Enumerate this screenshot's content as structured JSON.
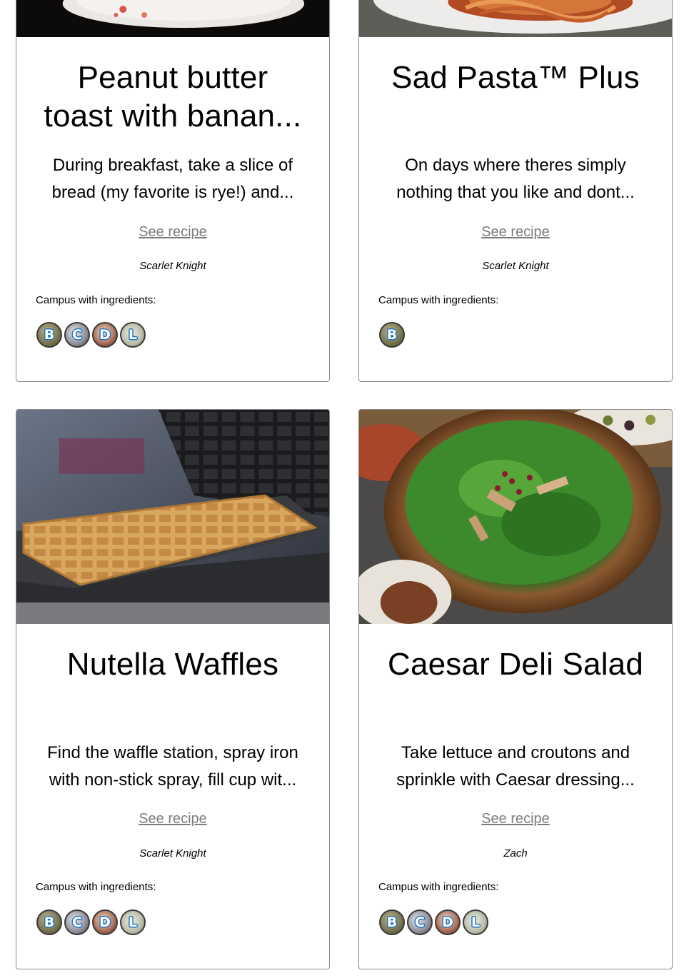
{
  "cards": [
    {
      "title": "Peanut butter toast with banan...",
      "title_line1": "Peanut butter",
      "title_line2": "toast with banan...",
      "desc_line1": "During breakfast, take a slice of",
      "desc_line2": "bread (my favorite is rye!) and...",
      "link": "See recipe",
      "author": "Scarlet Knight",
      "campus_label": "Campus with ingredients:",
      "campuses": [
        "B",
        "C",
        "D",
        "L"
      ]
    },
    {
      "title_line1": "Sad Pasta™ Plus",
      "desc_line1": "On days where theres simply",
      "desc_line2": "nothing that you like and dont...",
      "link": "See recipe",
      "author": "Scarlet Knight",
      "campus_label": "Campus with ingredients:",
      "campuses": [
        "B"
      ]
    },
    {
      "title_line1": "Nutella Waffles",
      "desc_line1": "Find the waffle station, spray iron",
      "desc_line2": "with non-stick spray, fill cup wit...",
      "link": "See recipe",
      "author": "Scarlet Knight",
      "campus_label": "Campus with ingredients:",
      "campuses": [
        "B",
        "C",
        "D",
        "L"
      ]
    },
    {
      "title_line1": "Caesar Deli Salad",
      "desc_line1": "Take lettuce and croutons and",
      "desc_line2": "sprinkle with Caesar dressing...",
      "link": "See recipe",
      "author": "Zach",
      "campus_label": "Campus with ingredients:",
      "campuses": [
        "B",
        "C",
        "D",
        "L"
      ]
    }
  ],
  "colors": {
    "link": "#7d7d7d",
    "border": "#8a8a8a",
    "badge_letter_outline": "#1e73c8"
  },
  "icons": [
    "campus-b-icon",
    "campus-c-icon",
    "campus-d-icon",
    "campus-l-icon"
  ]
}
